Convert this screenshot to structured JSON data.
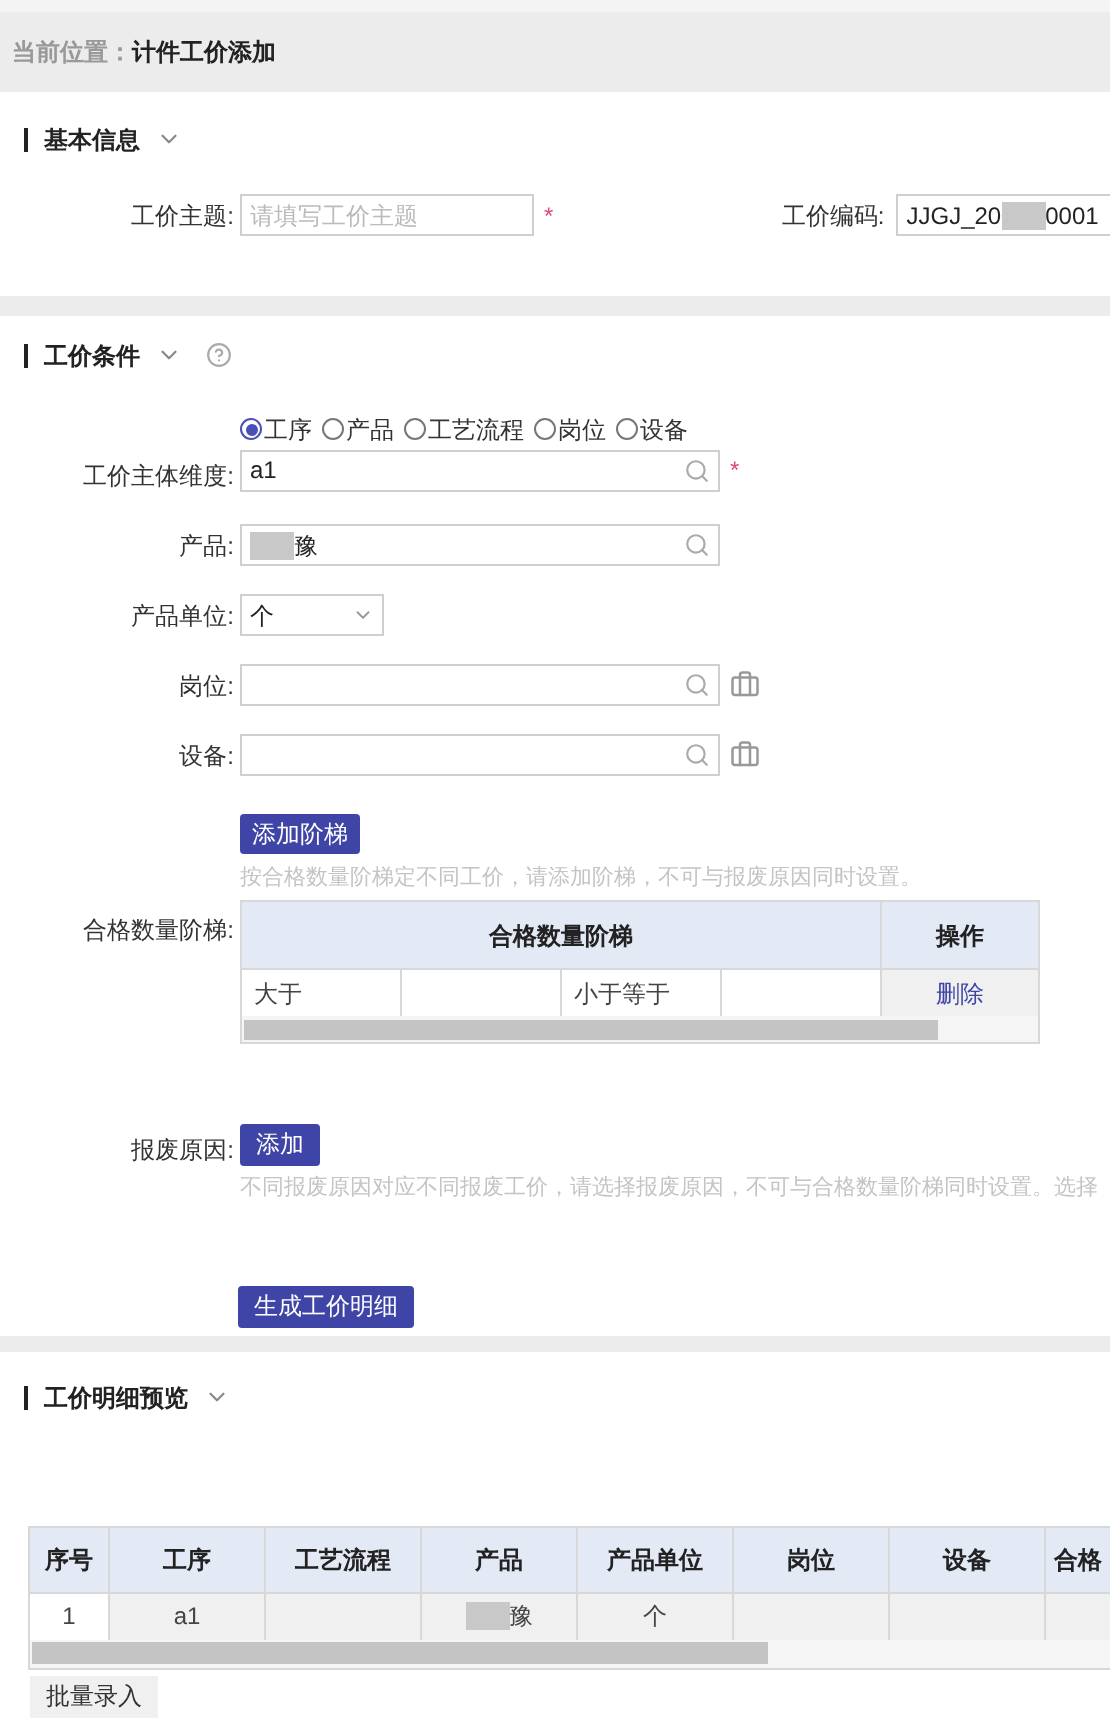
{
  "breadcrumb": {
    "label": "当前位置：",
    "current": "计件工价添加"
  },
  "basic_info": {
    "title": "基本信息",
    "fields": [
      {
        "label": "工价主题:",
        "placeholder": "请填写工价主题",
        "required_mark": "*"
      },
      {
        "label": "工价编码:",
        "value": "JJGJ_20",
        "redacted": true,
        "value_end": "0001"
      }
    ]
  },
  "conditions": {
    "title": "工价条件",
    "dimension": {
      "label": "工价主体维度:",
      "options": [
        {
          "label": "工序",
          "selected": true
        },
        {
          "label": "产品",
          "selected": false
        },
        {
          "label": "工艺流程",
          "selected": false
        },
        {
          "label": "岗位",
          "selected": false
        },
        {
          "label": "设备",
          "selected": false
        }
      ],
      "value": "a1",
      "required_mark": "*"
    },
    "fields": [
      {
        "kind": "search",
        "label": "产品:",
        "value": "豫",
        "redacted": true
      },
      {
        "kind": "select",
        "label": "产品单位:",
        "value": "个"
      },
      {
        "kind": "search_picker",
        "label": "岗位:"
      },
      {
        "kind": "search_picker",
        "label": "设备:"
      }
    ],
    "ladder": {
      "button": "添加阶梯",
      "hint": "按合格数量阶梯定不同工价，请添加阶梯，不可与报废原因同时设置。",
      "label": "合格数量阶梯:",
      "header": "合格数量阶梯",
      "action_header": "操作",
      "rows": [
        {
          "from_op": "大于",
          "to_op": "小于等于",
          "action": "删除"
        }
      ]
    },
    "scrap": {
      "label": "报废原因:",
      "button": "添加",
      "hint": "不同报废原因对应不同报废工价，请选择报废原因，不可与合格数量阶梯同时设置。选择"
    },
    "generate_button": "生成工价明细"
  },
  "preview": {
    "title": "工价明细预览",
    "columns": [
      "序号",
      "工序",
      "工艺流程",
      "产品",
      "产品单位",
      "岗位",
      "设备",
      "合格"
    ],
    "rows": [
      {
        "no": "1",
        "process": "a1",
        "product": "豫",
        "product_redacted": true,
        "unit": "个"
      }
    ],
    "batch_button": "批量录入"
  }
}
